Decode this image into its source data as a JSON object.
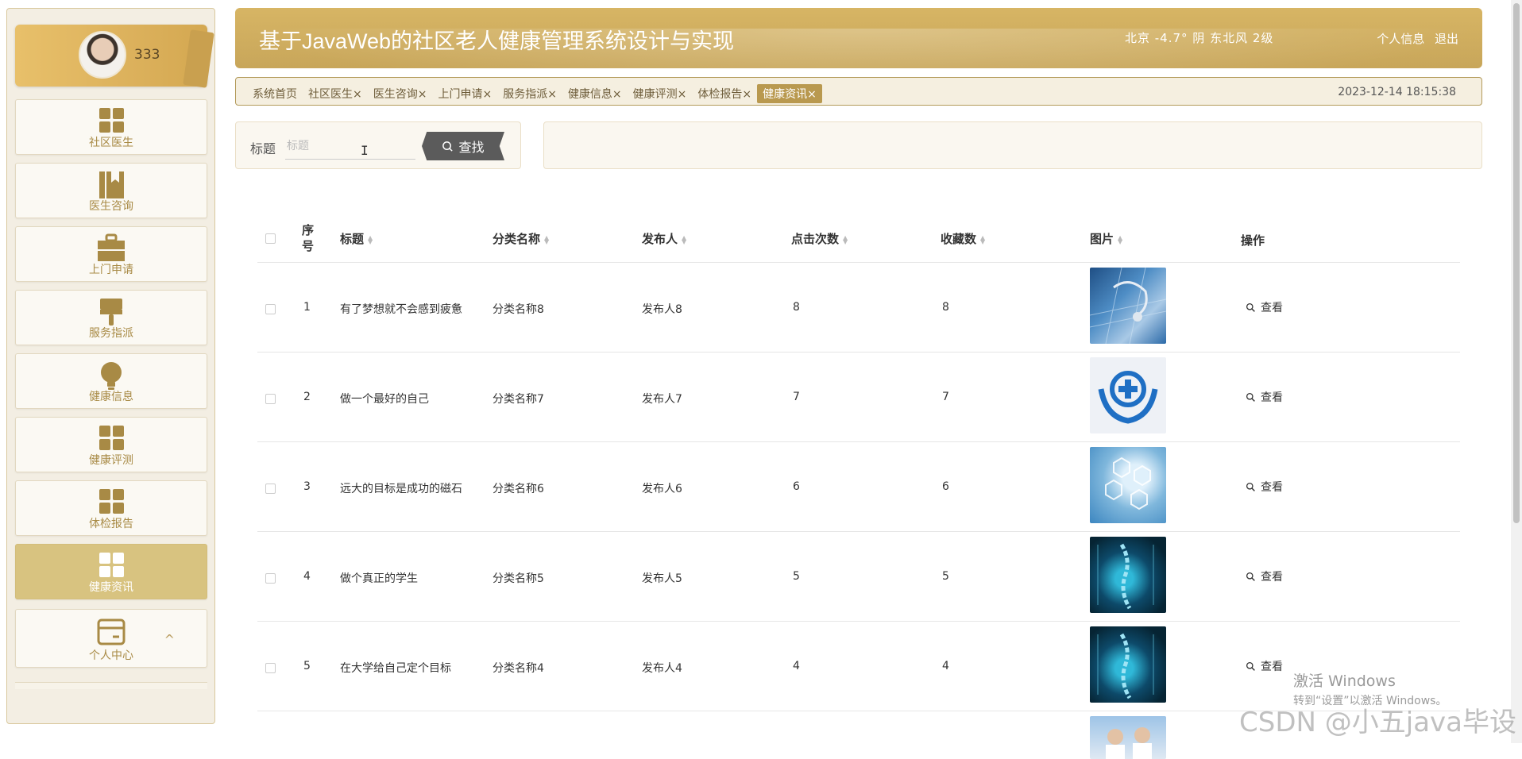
{
  "user": {
    "name": "333"
  },
  "sidebar": {
    "items": [
      {
        "label": "社区医生",
        "icon": "grid-icon"
      },
      {
        "label": "医生咨询",
        "icon": "book-icon"
      },
      {
        "label": "上门申请",
        "icon": "briefcase-icon"
      },
      {
        "label": "服务指派",
        "icon": "brush-icon"
      },
      {
        "label": "健康信息",
        "icon": "bulb-icon"
      },
      {
        "label": "健康评测",
        "icon": "grid-icon"
      },
      {
        "label": "体检报告",
        "icon": "grid-icon"
      },
      {
        "label": "健康资讯",
        "icon": "grid-icon",
        "active": true
      },
      {
        "label": "个人中心",
        "icon": "card-icon",
        "chevron": "^"
      }
    ]
  },
  "header": {
    "title": "基于JavaWeb的社区老人健康管理系统设计与实现",
    "weather": "北京  -4.7°  阴  东北风  2级",
    "profile_link": "个人信息",
    "logout_link": "退出"
  },
  "tabs": [
    {
      "label": "系统首页"
    },
    {
      "label": "社区医生×"
    },
    {
      "label": "医生咨询×"
    },
    {
      "label": "上门申请×"
    },
    {
      "label": "服务指派×"
    },
    {
      "label": "健康信息×"
    },
    {
      "label": "健康评测×"
    },
    {
      "label": "体检报告×"
    },
    {
      "label": "健康资讯×",
      "active": true
    }
  ],
  "datetime": "2023-12-14 18:15:38",
  "search": {
    "label": "标题",
    "placeholder": "标题",
    "button": "查找"
  },
  "table": {
    "headers": {
      "index": "序号",
      "title": "标题",
      "category": "分类名称",
      "publisher": "发布人",
      "clicks": "点击次数",
      "favorites": "收藏数",
      "image": "图片",
      "actions": "操作"
    },
    "rows": [
      {
        "index": "1",
        "title": "有了梦想就不会感到疲惫",
        "category": "分类名称8",
        "publisher": "发布人8",
        "clicks": "8",
        "favorites": "8",
        "action": "查看",
        "image": "stethoscope-keyboard"
      },
      {
        "index": "2",
        "title": "做一个最好的自己",
        "category": "分类名称7",
        "publisher": "发布人7",
        "clicks": "7",
        "favorites": "7",
        "action": "查看",
        "image": "medical-hands-logo"
      },
      {
        "index": "3",
        "title": "远大的目标是成功的磁石",
        "category": "分类名称6",
        "publisher": "发布人6",
        "clicks": "6",
        "favorites": "6",
        "action": "查看",
        "image": "medical-icons-doctor"
      },
      {
        "index": "4",
        "title": "做个真正的学生",
        "category": "分类名称5",
        "publisher": "发布人5",
        "clicks": "5",
        "favorites": "5",
        "action": "查看",
        "image": "xray-spine"
      },
      {
        "index": "5",
        "title": "在大学给自己定个目标",
        "category": "分类名称4",
        "publisher": "发布人4",
        "clicks": "4",
        "favorites": "4",
        "action": "查看",
        "image": "xray-spine"
      }
    ]
  },
  "watermarks": {
    "windows_line1": "激活 Windows",
    "windows_line2": "转到“设置”以激活 Windows。",
    "csdn": "CSDN @小五java毕设"
  }
}
